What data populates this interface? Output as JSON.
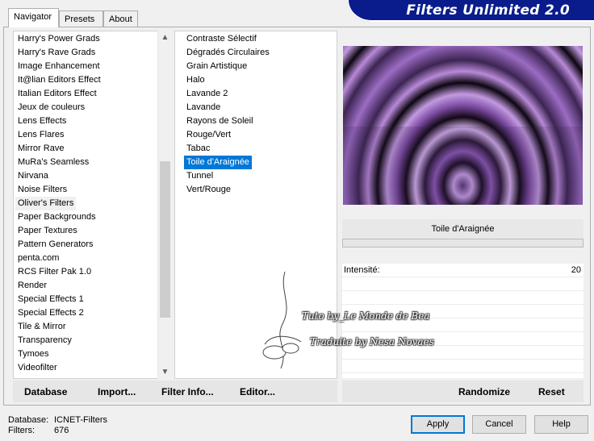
{
  "tabs": [
    "Navigator",
    "Presets",
    "About"
  ],
  "banner_title": "Filters Unlimited 2.0",
  "categories": [
    "Harry's Power Grads",
    "Harry's Rave Grads",
    "Image Enhancement",
    "It@lian Editors Effect",
    "Italian Editors Effect",
    "Jeux de couleurs",
    "Lens Effects",
    "Lens Flares",
    "Mirror Rave",
    "MuRa's Seamless",
    "Nirvana",
    "Noise Filters",
    "Oliver's Filters",
    "Paper Backgrounds",
    "Paper Textures",
    "Pattern Generators",
    "penta.com",
    "RCS Filter Pak 1.0",
    "Render",
    "Special Effects 1",
    "Special Effects 2",
    "Tile & Mirror",
    "Transparency",
    "Tymoes",
    "Videofilter"
  ],
  "selected_category": "Oliver's Filters",
  "filters": [
    "Contraste Sélectif",
    "Dégradés Circulaires",
    "Grain Artistique",
    "Halo",
    "Lavande 2",
    "Lavande",
    "Rayons de Soleil",
    "Rouge/Vert",
    "Tabac",
    "Toile d'Araignée",
    "Tunnel",
    "Vert/Rouge"
  ],
  "selected_filter": "Toile d'Araignée",
  "filter_title": "Toile d'Araignée",
  "params": [
    {
      "label": "Intensité:",
      "value": "20"
    }
  ],
  "watermark": {
    "line1": "Tuto by_Le Monde de Bea",
    "line2": "Traduite by Nesa Novaes"
  },
  "left_buttons": [
    "Database",
    "Import...",
    "Filter Info...",
    "Editor..."
  ],
  "right_buttons": [
    "Randomize",
    "Reset"
  ],
  "status": {
    "database_label": "Database:",
    "database_value": "ICNET-Filters",
    "filters_label": "Filters:",
    "filters_value": "676"
  },
  "dialog_buttons": [
    "Apply",
    "Cancel",
    "Help"
  ],
  "colors": {
    "banner": "#0a1c8c",
    "selection": "#0078d7",
    "preview_light": "#c9a0e8",
    "preview_dark": "#1a0d22"
  }
}
